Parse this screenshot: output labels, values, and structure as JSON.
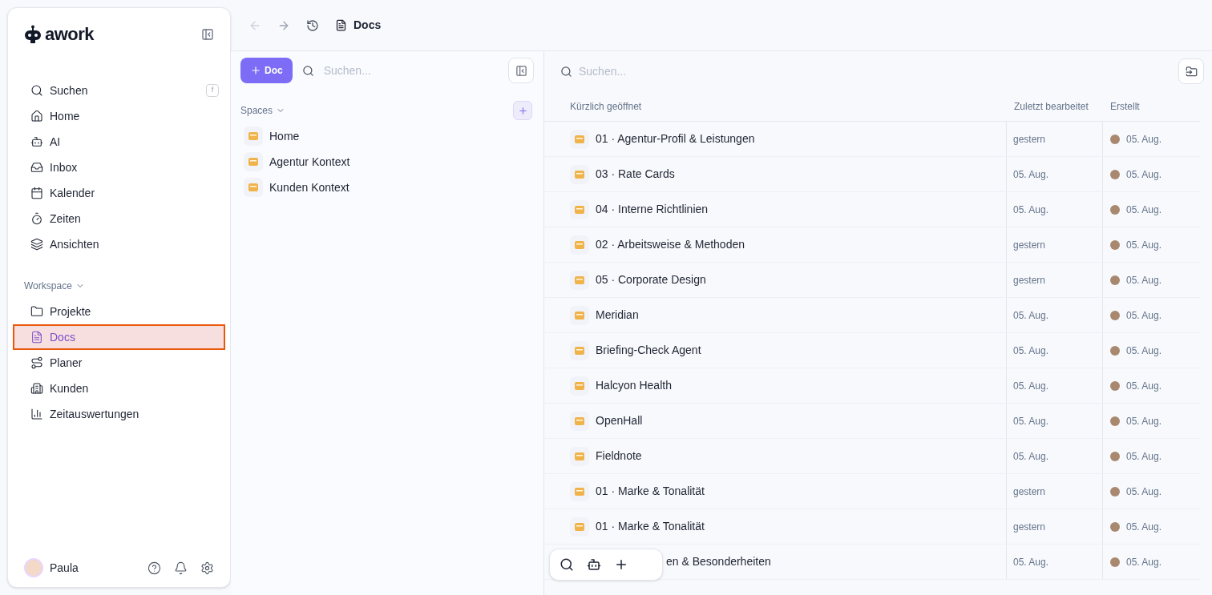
{
  "sidebar": {
    "logo": "awork",
    "shortcut": "f",
    "nav": [
      {
        "label": "Suchen",
        "selected": false
      },
      {
        "label": "Home",
        "selected": false
      },
      {
        "label": "AI",
        "selected": false
      },
      {
        "label": "Inbox",
        "selected": false
      },
      {
        "label": "Kalender",
        "selected": false
      },
      {
        "label": "Zeiten",
        "selected": false
      },
      {
        "label": "Ansichten",
        "selected": false
      }
    ],
    "section": "Workspace",
    "workspace": [
      {
        "label": "Projekte",
        "selected": false
      },
      {
        "label": "Docs",
        "selected": true
      },
      {
        "label": "Planer",
        "selected": false
      },
      {
        "label": "Kunden",
        "selected": false
      },
      {
        "label": "Zeitauswertungen",
        "selected": false
      }
    ],
    "user": {
      "name": "Paula"
    }
  },
  "topbar": {
    "title": "Docs"
  },
  "docs_panel": {
    "new_button": "Doc",
    "search_placeholder": "Suchen...",
    "spaces_label": "Spaces",
    "spaces": [
      {
        "name": "Home"
      },
      {
        "name": "Agentur Kontext"
      },
      {
        "name": "Kunden Kontext"
      }
    ]
  },
  "list": {
    "search_placeholder": "Suchen...",
    "columns": [
      "Kürzlich geöffnet",
      "Zuletzt bearbeitet",
      "Erstellt"
    ],
    "rows": [
      {
        "title": "01 · Agentur-Profil & Leistungen",
        "edited": "gestern",
        "created": "05. Aug."
      },
      {
        "title": "03 · Rate Cards",
        "edited": "05. Aug.",
        "created": "05. Aug."
      },
      {
        "title": "04 · Interne Richtlinien",
        "edited": "05. Aug.",
        "created": "05. Aug."
      },
      {
        "title": "02 · Arbeitsweise & Methoden",
        "edited": "gestern",
        "created": "05. Aug."
      },
      {
        "title": "05 · Corporate Design",
        "edited": "gestern",
        "created": "05. Aug."
      },
      {
        "title": "Meridian",
        "edited": "05. Aug.",
        "created": "05. Aug."
      },
      {
        "title": "Briefing-Check Agent",
        "edited": "05. Aug.",
        "created": "05. Aug."
      },
      {
        "title": "Halcyon Health",
        "edited": "05. Aug.",
        "created": "05. Aug."
      },
      {
        "title": "OpenHall",
        "edited": "05. Aug.",
        "created": "05. Aug."
      },
      {
        "title": "Fieldnote",
        "edited": "05. Aug.",
        "created": "05. Aug."
      },
      {
        "title": "01 · Marke & Tonalität",
        "edited": "gestern",
        "created": "05. Aug."
      },
      {
        "title": "01 · Marke & Tonalität",
        "edited": "gestern",
        "created": "05. Aug."
      },
      {
        "title": "en & Besonderheiten",
        "edited": "05. Aug.",
        "created": "05. Aug.",
        "partly_covered": true
      }
    ]
  }
}
